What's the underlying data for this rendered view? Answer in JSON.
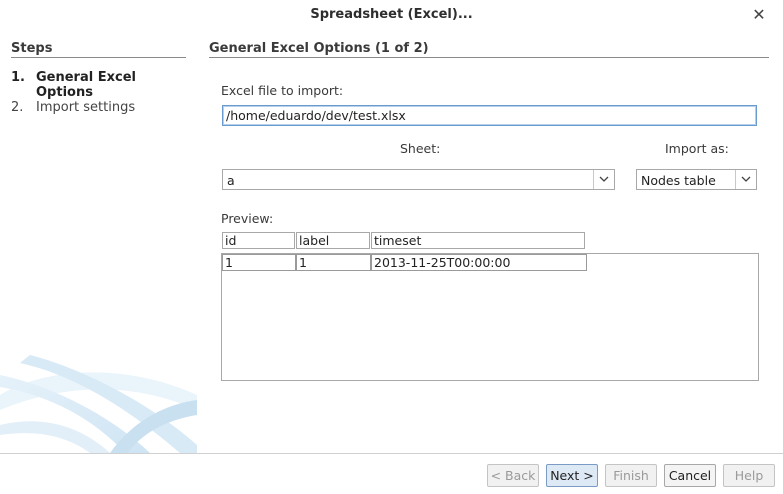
{
  "window": {
    "title": "Spreadsheet (Excel)..."
  },
  "steps": {
    "title": "Steps",
    "items": [
      {
        "num": "1.",
        "label": "General Excel Options"
      },
      {
        "num": "2.",
        "label": "Import settings"
      }
    ]
  },
  "panel": {
    "title": "General Excel Options (1 of 2)",
    "file_label": "Excel file to import:",
    "file_value": "/home/eduardo/dev/test.xlsx",
    "sheet_label": "Sheet:",
    "sheet_value": "a",
    "import_as_label": "Import as:",
    "import_as_value": "Nodes table",
    "preview_label": "Preview:",
    "columns": [
      "id",
      "label",
      "timeset"
    ],
    "rows": [
      [
        "1",
        "1",
        "2013-11-25T00:00:00"
      ]
    ]
  },
  "buttons": {
    "back": "< Back",
    "next": "Next >",
    "finish": "Finish",
    "cancel": "Cancel",
    "help": "Help"
  }
}
